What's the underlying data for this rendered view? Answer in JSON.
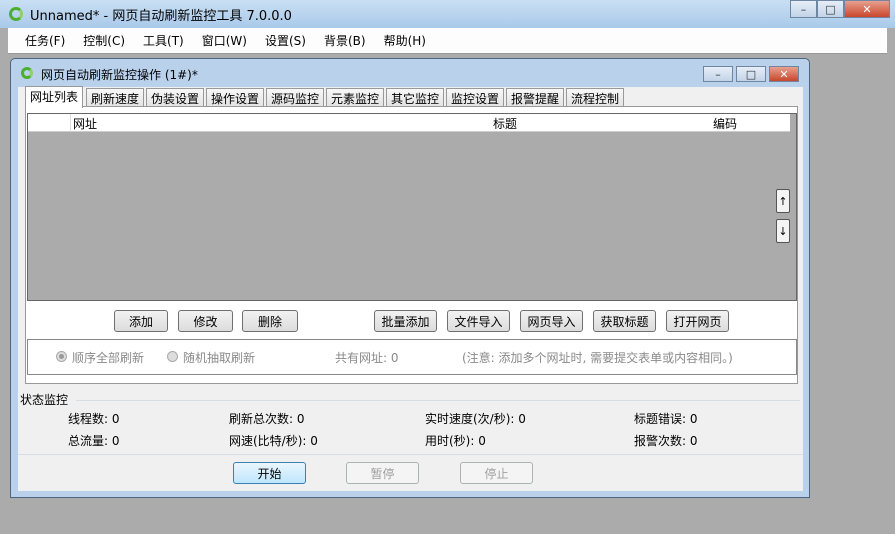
{
  "window": {
    "title": "Unnamed* - 网页自动刷新监控工具 7.0.0.0",
    "minimize": "–",
    "maximize": "□",
    "close": "✕"
  },
  "menu": [
    "任务(F)",
    "控制(C)",
    "工具(T)",
    "窗口(W)",
    "设置(S)",
    "背景(B)",
    "帮助(H)"
  ],
  "child": {
    "title": "网页自动刷新监控操作  (1#)*"
  },
  "tabs": [
    "网址列表",
    "刷新速度",
    "伪装设置",
    "操作设置",
    "源码监控",
    "元素监控",
    "其它监控",
    "监控设置",
    "报警提醒",
    "流程控制"
  ],
  "list": {
    "columns": [
      "网址",
      "标题",
      "编码"
    ],
    "up": "↑",
    "down": "↓"
  },
  "buttons": {
    "add": "添加",
    "edit": "修改",
    "delete": "删除",
    "batch_add": "批量添加",
    "file_import": "文件导入",
    "web_import": "网页导入",
    "get_title": "获取标题",
    "open_page": "打开网页"
  },
  "options": {
    "sequential": "顺序全部刷新",
    "random": "随机抽取刷新",
    "total_urls": "共有网址: 0",
    "note": "(注意: 添加多个网址时, 需要提交表单或内容相同。)"
  },
  "status": {
    "label": "状态监控",
    "threads": "线程数: 0",
    "refresh_total": "刷新总次数: 0",
    "speed": "实时速度(次/秒): 0",
    "title_errors": "标题错误: 0",
    "traffic": "总流量: 0",
    "net_speed": "网速(比特/秒): 0",
    "elapsed": "用时(秒): 0",
    "alarms": "报警次数: 0"
  },
  "controls": {
    "start": "开始",
    "pause": "暂停",
    "stop": "停止"
  }
}
